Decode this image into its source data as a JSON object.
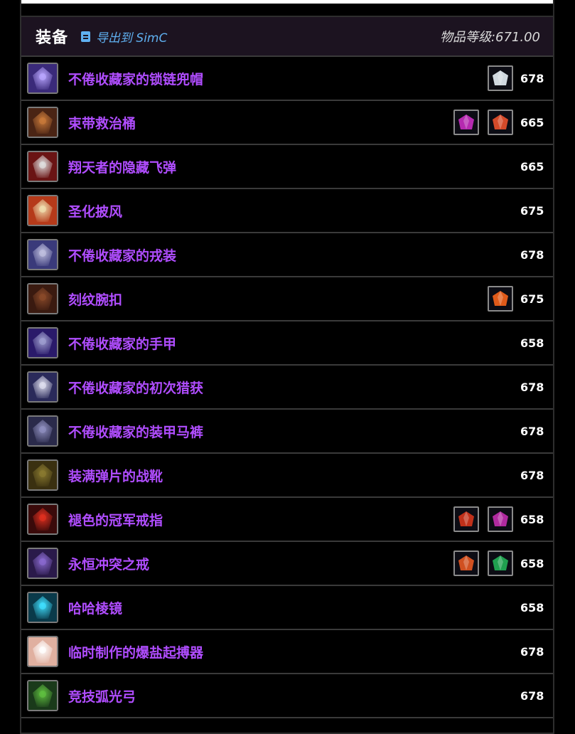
{
  "header": {
    "title": "装备",
    "export_label": "导出到 SimC",
    "item_level": "物品等级:671.00"
  },
  "items": [
    {
      "name": "不倦收藏家的锁链兜帽",
      "level": "678",
      "icon": "helm-icon",
      "colors": [
        "#3a2a7a",
        "#b9a6ff"
      ],
      "gems": [
        "#d0d8e0"
      ]
    },
    {
      "name": "束带救治桶",
      "level": "665",
      "icon": "neck-icon",
      "colors": [
        "#4a2414",
        "#c97a3a"
      ],
      "gems": [
        "#b52ab0",
        "#d44a2a"
      ]
    },
    {
      "name": "翔天者的隐藏飞弹",
      "level": "665",
      "icon": "shoulder-icon",
      "colors": [
        "#6a1414",
        "#e0e0e0"
      ],
      "gems": []
    },
    {
      "name": "圣化披风",
      "level": "675",
      "icon": "cloak-icon",
      "colors": [
        "#b53a1a",
        "#f0e0b0"
      ],
      "gems": []
    },
    {
      "name": "不倦收藏家的戎装",
      "level": "678",
      "icon": "chest-icon",
      "colors": [
        "#3a3a7a",
        "#c0c0e0"
      ],
      "gems": []
    },
    {
      "name": "刻纹腕扣",
      "level": "675",
      "icon": "bracer-icon",
      "colors": [
        "#3a1a10",
        "#8a4a2a"
      ],
      "gems": [
        "#e05a1a"
      ]
    },
    {
      "name": "不倦收藏家的手甲",
      "level": "658",
      "icon": "gloves-icon",
      "colors": [
        "#2a1a6a",
        "#a0a0d0"
      ],
      "gems": []
    },
    {
      "name": "不倦收藏家的初次猎获",
      "level": "678",
      "icon": "belt-icon",
      "colors": [
        "#2a2a5a",
        "#e0e0f0"
      ],
      "gems": []
    },
    {
      "name": "不倦收藏家的装甲马裤",
      "level": "678",
      "icon": "legs-icon",
      "colors": [
        "#2a2a4a",
        "#9090c0"
      ],
      "gems": []
    },
    {
      "name": "装满弹片的战靴",
      "level": "678",
      "icon": "boots-icon",
      "colors": [
        "#3a3010",
        "#8a7a30"
      ],
      "gems": []
    },
    {
      "name": "褪色的冠军戒指",
      "level": "658",
      "icon": "ring-icon",
      "colors": [
        "#3a0a0a",
        "#e03020"
      ],
      "gems": [
        "#c0301a",
        "#b02aa0"
      ]
    },
    {
      "name": "永恒冲突之戒",
      "level": "658",
      "icon": "ring2-icon",
      "colors": [
        "#2a1a4a",
        "#8a6ad0"
      ],
      "gems": [
        "#d05020",
        "#20a050"
      ]
    },
    {
      "name": "哈哈棱镜",
      "level": "658",
      "icon": "trinket-icon",
      "colors": [
        "#0a3a4a",
        "#40e0ff"
      ],
      "gems": []
    },
    {
      "name": "临时制作的爆盐起搏器",
      "level": "678",
      "icon": "trinket2-icon",
      "colors": [
        "#e0b0a0",
        "#ffffff"
      ],
      "gems": []
    },
    {
      "name": "竞技弧光弓",
      "level": "678",
      "icon": "bow-icon",
      "colors": [
        "#1a3a1a",
        "#60c040"
      ],
      "gems": []
    }
  ]
}
